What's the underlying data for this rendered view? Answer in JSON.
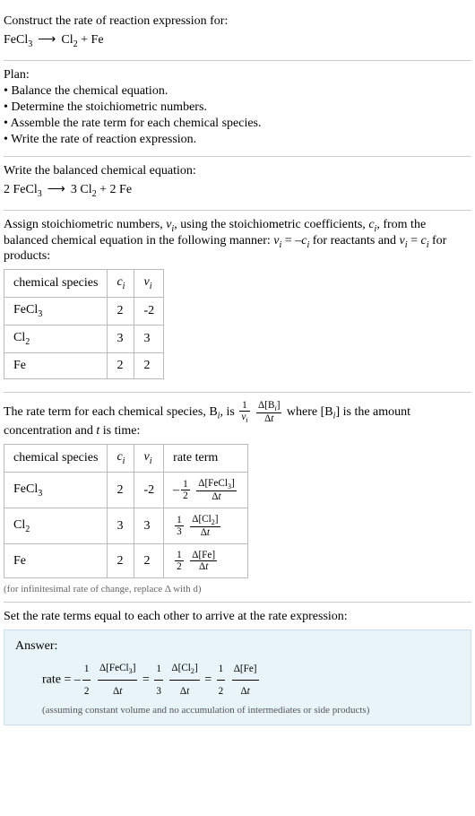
{
  "prompt": "Construct the rate of reaction expression for:",
  "plan_label": "Plan:",
  "plan_items": [
    "• Balance the chemical equation.",
    "• Determine the stoichiometric numbers.",
    "• Assemble the rate term for each chemical species.",
    "• Write the rate of reaction expression."
  ],
  "balanced_label": "Write the balanced chemical equation:",
  "stoich_label_a": "Assign stoichiometric numbers, ",
  "stoich_label_b": ", using the stoichiometric coefficients, ",
  "stoich_label_c": ", from the balanced chemical equation in the following manner: ",
  "stoich_label_d": " for reactants and ",
  "stoich_label_e": " for products:",
  "eq_reactants": "ν_i = -c_i",
  "eq_products": "ν_i = c_i",
  "table1": {
    "h1": "chemical species",
    "h2": "c",
    "h2s": "i",
    "h3": "ν",
    "h3s": "i",
    "r1c1a": "FeCl",
    "r1c1s": "3",
    "r1c2": "2",
    "r1c3": "-2",
    "r2c1a": "Cl",
    "r2c1s": "2",
    "r2c2": "3",
    "r2c3": "3",
    "r3c1": "Fe",
    "r3c2": "2",
    "r3c3": "2"
  },
  "rateterm_a": "The rate term for each chemical species, ",
  "rateterm_b": ", is ",
  "rateterm_c": " where ",
  "rateterm_d": " is the amount concentration and ",
  "rateterm_e": " is time:",
  "B_i": "B",
  "Bi_s": "i",
  "bracket_Bi": "[B_i]",
  "t_var": "t",
  "table2": {
    "h1": "chemical species",
    "h2": "c",
    "h2s": "i",
    "h3": "ν",
    "h3s": "i",
    "h4": "rate term",
    "r1c1a": "FeCl",
    "r1c1s": "3",
    "r1c2": "2",
    "r1c3": "-2",
    "r2c1a": "Cl",
    "r2c1s": "2",
    "r2c2": "3",
    "r2c3": "3",
    "r3c1": "Fe",
    "r3c2": "2",
    "r3c3": "2"
  },
  "note_inf": "(for infinitesimal rate of change, replace Δ with d)",
  "set_equal": "Set the rate terms equal to each other to arrive at the rate expression:",
  "answer_label": "Answer:",
  "rate_eq": "rate = ",
  "answer_note": "(assuming constant volume and no accumulation of intermediates or side products)",
  "chart_data": {
    "type": "table",
    "reaction_unbalanced": "FeCl3 → Cl2 + Fe",
    "reaction_balanced": "2 FeCl3 → 3 Cl2 + 2 Fe",
    "species": [
      {
        "name": "FeCl3",
        "c_i": 2,
        "nu_i": -2,
        "rate_term": "-(1/2) Δ[FeCl3]/Δt"
      },
      {
        "name": "Cl2",
        "c_i": 3,
        "nu_i": 3,
        "rate_term": "(1/3) Δ[Cl2]/Δt"
      },
      {
        "name": "Fe",
        "c_i": 2,
        "nu_i": 2,
        "rate_term": "(1/2) Δ[Fe]/Δt"
      }
    ],
    "rate_expression": "rate = -(1/2) Δ[FeCl3]/Δt = (1/3) Δ[Cl2]/Δt = (1/2) Δ[Fe]/Δt"
  }
}
